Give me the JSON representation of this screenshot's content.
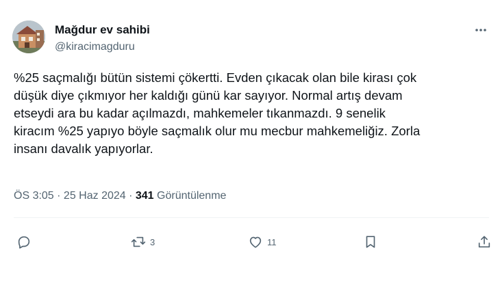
{
  "author": {
    "display_name": "Mağdur ev sahibi",
    "handle": "@kiracimagduru",
    "avatar_icon": "avatar-house-photo"
  },
  "more_icon": "more-horizontal-icon",
  "tweet": {
    "lines": [
      "%25 saçmalığı bütün sistemi çökertti. Evden çıkacak olan bile kirası çok",
      "düşük diye çıkmıyor her kaldığı günü kar sayıyor. Normal artış devam",
      "etseydi ara bu kadar açılmazdı, mahkemeler tıkanmazdı. 9 senelik",
      "kiracım %25 yapıyo böyle saçmalık olur mu mecbur mahkemeliğiz. Zorla",
      "insanı davalık yapıyorlar."
    ]
  },
  "meta": {
    "time": "ÖS 3:05",
    "separator": " · ",
    "date": "25 Haz 2024",
    "views_count": "341",
    "views_label": " Görüntülenme"
  },
  "actions": {
    "reply": {
      "icon": "reply-icon"
    },
    "retweet": {
      "icon": "retweet-icon",
      "count": "3"
    },
    "like": {
      "icon": "heart-icon",
      "count": "11"
    },
    "bookmark": {
      "icon": "bookmark-icon"
    },
    "share": {
      "icon": "share-icon"
    }
  },
  "colors": {
    "text": "#0f1419",
    "secondary": "#536471",
    "divider": "#eff3f4"
  }
}
